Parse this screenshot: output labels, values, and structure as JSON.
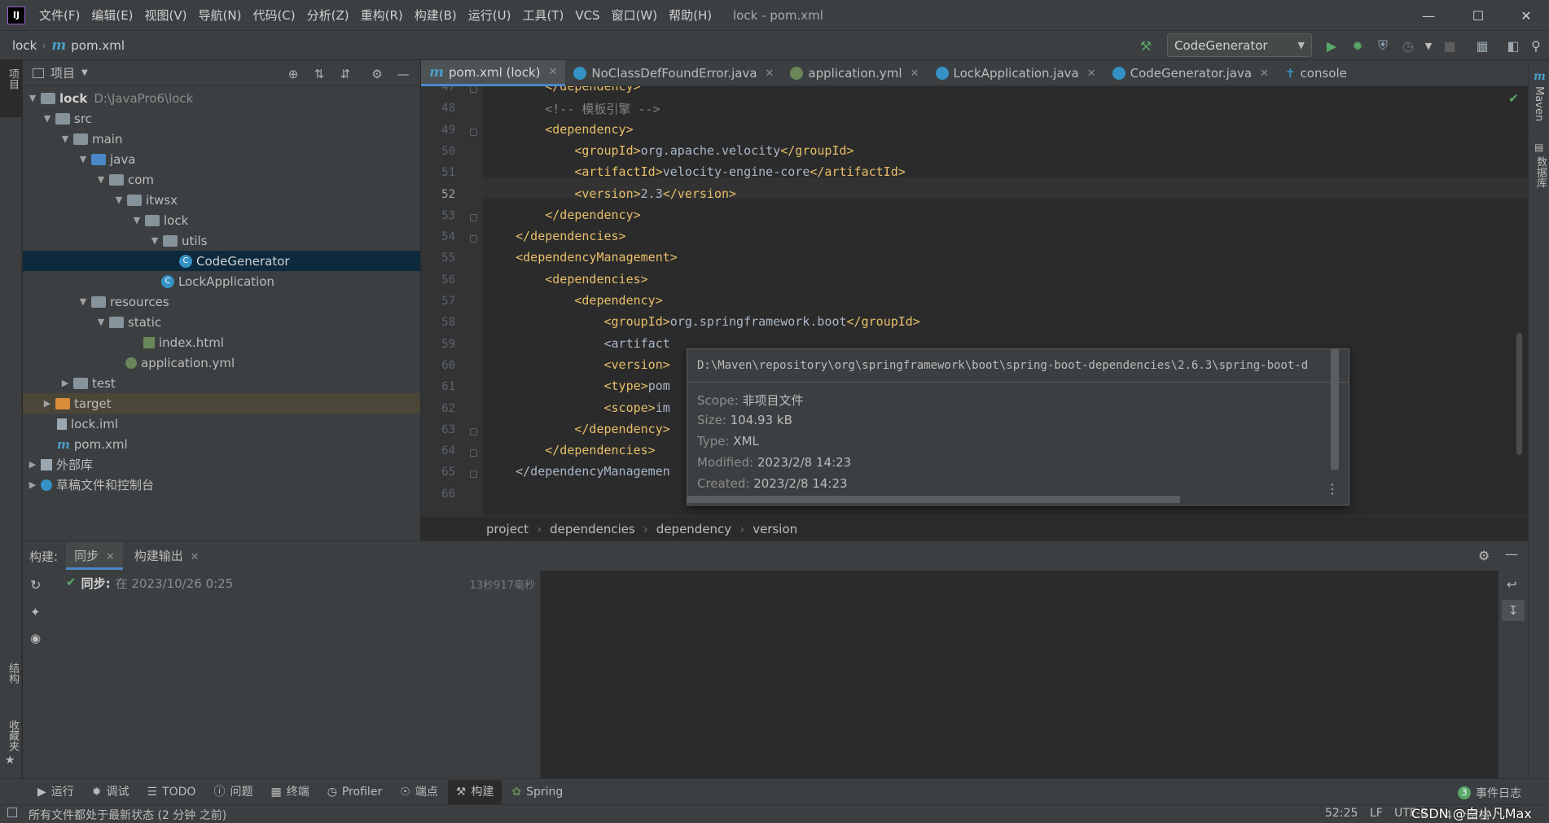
{
  "menu": [
    "文件(F)",
    "编辑(E)",
    "视图(V)",
    "导航(N)",
    "代码(C)",
    "分析(Z)",
    "重构(R)",
    "构建(B)",
    "运行(U)",
    "工具(T)",
    "VCS",
    "窗口(W)",
    "帮助(H)"
  ],
  "window_title": "lock - pom.xml",
  "app_logo": "IJ",
  "nav": {
    "project": "lock",
    "file": "pom.xml",
    "run_config": "CodeGenerator"
  },
  "left_stripe": {
    "project_label": "项目",
    "structure_label": "结构",
    "favorites_label": "收藏夹"
  },
  "right_stripe": {
    "maven_label": "Maven",
    "database_label": "数据库"
  },
  "project_panel": {
    "title": "项目",
    "tree": [
      {
        "label": "lock",
        "hint": "D:\\JavaPro6\\lock"
      },
      {
        "label": "src"
      },
      {
        "label": "main"
      },
      {
        "label": "java"
      },
      {
        "label": "com"
      },
      {
        "label": "itwsx"
      },
      {
        "label": "lock"
      },
      {
        "label": "utils"
      },
      {
        "label": "CodeGenerator"
      },
      {
        "label": "LockApplication"
      },
      {
        "label": "resources"
      },
      {
        "label": "static"
      },
      {
        "label": "index.html"
      },
      {
        "label": "application.yml"
      },
      {
        "label": "test"
      },
      {
        "label": "target"
      },
      {
        "label": "lock.iml"
      },
      {
        "label": "pom.xml"
      },
      {
        "label": "外部库"
      },
      {
        "label": "草稿文件和控制台"
      }
    ]
  },
  "editor_tabs": [
    {
      "label": "pom.xml (lock)",
      "active": true
    },
    {
      "label": "NoClassDefFoundError.java"
    },
    {
      "label": "application.yml"
    },
    {
      "label": "LockApplication.java"
    },
    {
      "label": "CodeGenerator.java"
    },
    {
      "label": "console"
    }
  ],
  "editor": {
    "current_line": 52,
    "lines": [
      {
        "n": "47",
        "text": "        </dependency>"
      },
      {
        "n": "48",
        "text": "        <!-- 模板引擎 -->"
      },
      {
        "n": "49",
        "text": "        <dependency>"
      },
      {
        "n": "50",
        "text": "            <groupId>org.apache.velocity</groupId>"
      },
      {
        "n": "51",
        "text": "            <artifactId>velocity-engine-core</artifactId>"
      },
      {
        "n": "52",
        "text": "            <version>2.3</version>"
      },
      {
        "n": "53",
        "text": "        </dependency>"
      },
      {
        "n": "54",
        "text": "    </dependencies>"
      },
      {
        "n": "55",
        "text": "    <dependencyManagement>"
      },
      {
        "n": "56",
        "text": "        <dependencies>"
      },
      {
        "n": "57",
        "text": "            <dependency>"
      },
      {
        "n": "58",
        "text": "                <groupId>org.springframework.boot</groupId>"
      },
      {
        "n": "59",
        "text": "                <artifact"
      },
      {
        "n": "60",
        "text": "                <version>"
      },
      {
        "n": "61",
        "text": "                <type>pom"
      },
      {
        "n": "62",
        "text": "                <scope>im"
      },
      {
        "n": "63",
        "text": "            </dependency>"
      },
      {
        "n": "64",
        "text": "        </dependencies>"
      },
      {
        "n": "65",
        "text": "    </dependencyManagemen"
      },
      {
        "n": "66",
        "text": ""
      }
    ]
  },
  "editor_breadcrumb": [
    "project",
    "dependencies",
    "dependency",
    "version"
  ],
  "file_popup": {
    "path": "D:\\Maven\\repository\\org\\springframework\\boot\\spring-boot-dependencies\\2.6.3\\spring-boot-d",
    "rows": [
      {
        "key": "Scope:",
        "value": "非项目文件"
      },
      {
        "key": "Size:",
        "value": "104.93 kB"
      },
      {
        "key": "Type:",
        "value": "XML"
      },
      {
        "key": "Modified:",
        "value": "2023/2/8 14:23"
      },
      {
        "key": "Created:",
        "value": "2023/2/8 14:23"
      }
    ]
  },
  "build": {
    "label": "构建:",
    "tabs": [
      "同步",
      "构建输出"
    ],
    "sync_label": "同步:",
    "sync_detail": "在 2023/10/26 0:25",
    "sync_time": "13秒917毫秒"
  },
  "tool_buttons": [
    "运行",
    "调试",
    "TODO",
    "问题",
    "终端",
    "Profiler",
    "端点",
    "构建",
    "Spring"
  ],
  "event_log": {
    "count": "3",
    "label": "事件日志"
  },
  "status": {
    "message": "所有文件都处于最新状态 (2 分钟 之前)",
    "position": "52:25",
    "line_sep": "LF",
    "encoding": "UTF-8",
    "indent": "4 个空格",
    "watermark": "CSDN @白小凡Max"
  }
}
